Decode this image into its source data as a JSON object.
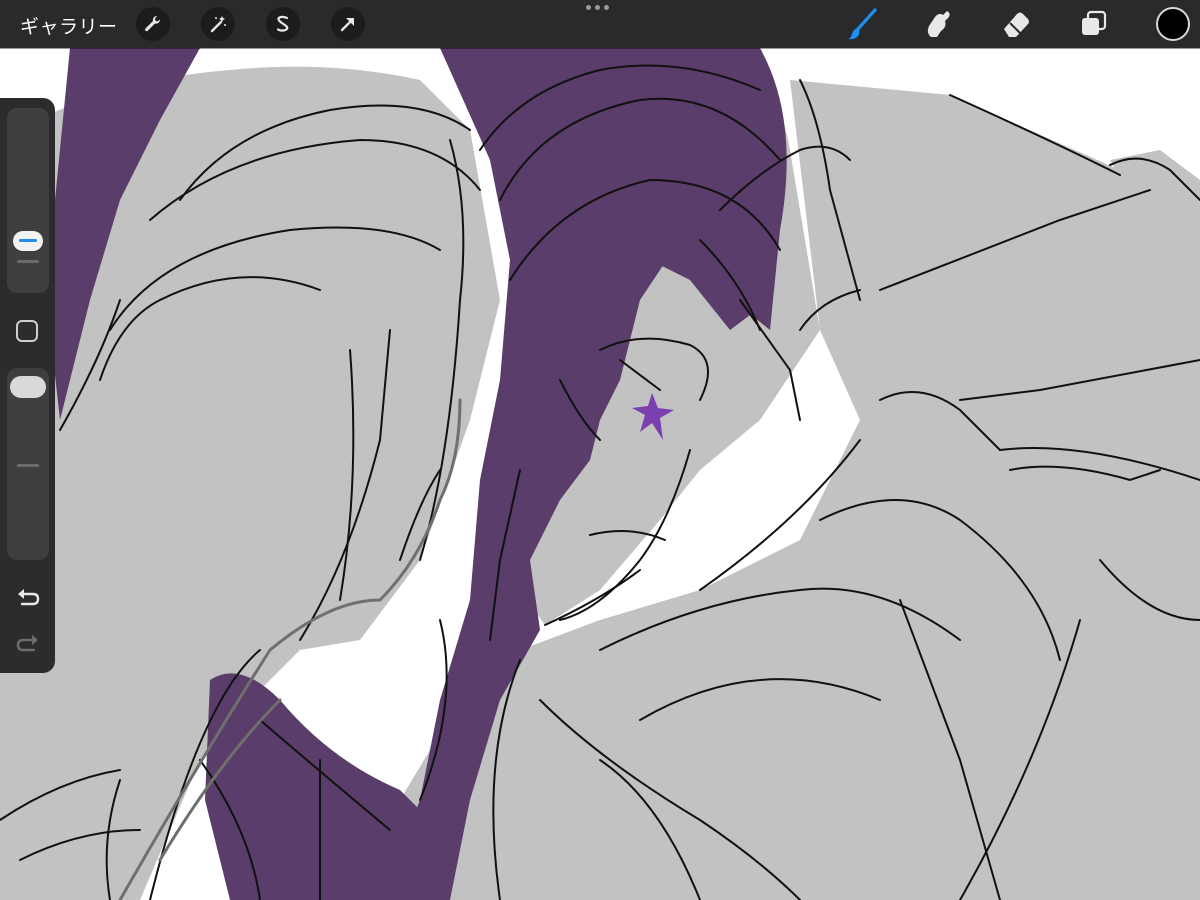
{
  "topbar": {
    "gallery_label": "ギャラリー",
    "actions": [
      {
        "icon": "wrench-icon"
      },
      {
        "icon": "magic-wand-icon"
      },
      {
        "icon": "selection-icon"
      },
      {
        "icon": "transform-arrow-icon"
      }
    ],
    "tools": [
      {
        "icon": "brush-icon",
        "active": true
      },
      {
        "icon": "smudge-icon",
        "active": false
      },
      {
        "icon": "eraser-icon",
        "active": false
      },
      {
        "icon": "layers-icon",
        "active": false
      }
    ],
    "current_color": "#000000"
  },
  "sidebar": {
    "brush_size_level": 0.72,
    "opacity_level": 1.0,
    "undo_icon": "undo-icon",
    "redo_icon": "redo-icon"
  },
  "colors": {
    "accent": "#1f8ef1",
    "hair": "#5a3d6a",
    "fill": "#c2c2c2",
    "line": "#111111",
    "star": "#7c3fb0"
  }
}
